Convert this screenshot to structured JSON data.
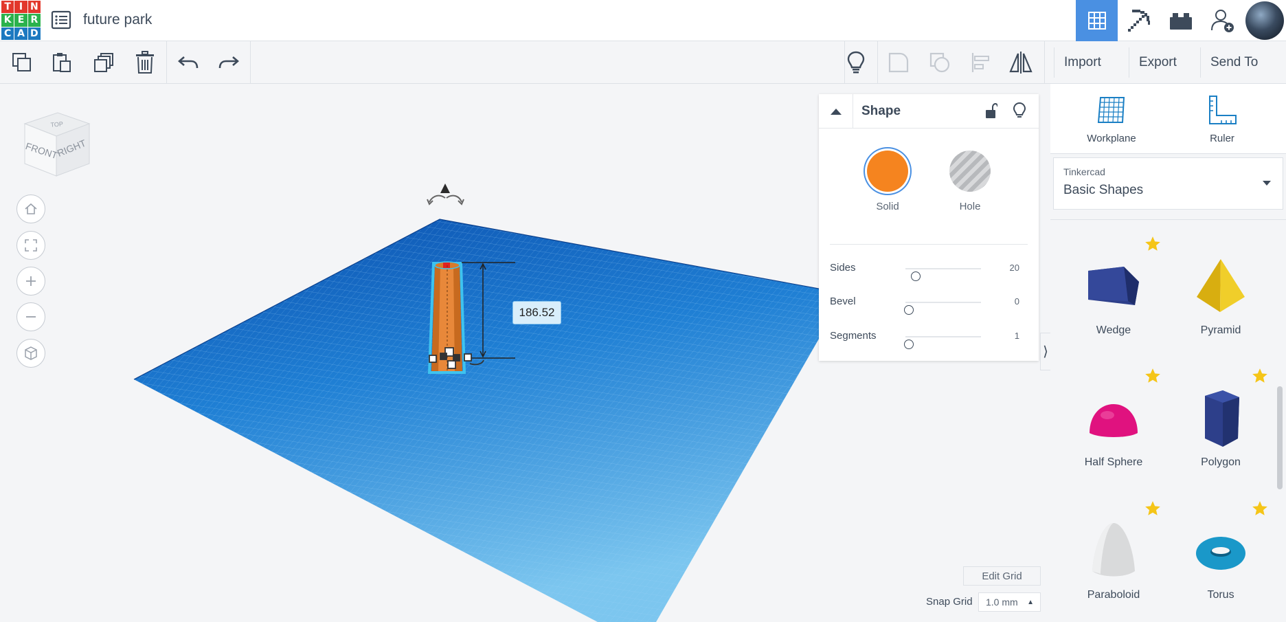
{
  "app": {
    "logo_letters": [
      "T",
      "I",
      "N",
      "K",
      "E",
      "R",
      "C",
      "A",
      "D"
    ],
    "logo_colors": [
      "#e2372b",
      "#e2372b",
      "#e2372b",
      "#2bb24c",
      "#2bb24c",
      "#2bb24c",
      "#1c79c0",
      "#1c79c0",
      "#1c79c0"
    ],
    "title": "future park",
    "accent": "#4a90e2"
  },
  "top_nav": {
    "items": [
      {
        "icon": "grid-3d-icon",
        "active": true
      },
      {
        "icon": "pickaxe-icon",
        "active": false
      },
      {
        "icon": "bricks-icon",
        "active": false
      },
      {
        "icon": "add-user-icon",
        "active": false
      }
    ]
  },
  "toolbar": {
    "actions": [
      "copy-icon",
      "paste-icon",
      "duplicate-icon",
      "delete-icon",
      "undo-icon",
      "redo-icon"
    ],
    "right_actions": [
      "notes-bulb-icon",
      "group-icon",
      "ungroup-icon",
      "align-icon",
      "mirror-icon"
    ],
    "import_label": "Import",
    "export_label": "Export",
    "send_to_label": "Send To"
  },
  "viewport": {
    "view_cube": {
      "top": "TOP",
      "front": "FRONT",
      "right": "RIGHT"
    },
    "nav_buttons": [
      "home-icon",
      "fit-view-icon",
      "zoom-in-icon",
      "zoom-out-icon",
      "perspective-icon"
    ],
    "dimension_label": "186.52",
    "edit_grid_label": "Edit Grid",
    "snap_grid_label": "Snap Grid",
    "snap_grid_value": "1.0 mm",
    "workplane_color": "#2a82d6",
    "selected_shape_color": "#e07a2a",
    "selection_outline_color": "#3ec3ef"
  },
  "inspector": {
    "title": "Shape",
    "solid_label": "Solid",
    "hole_label": "Hole",
    "solid_color": "#f5841f",
    "properties": [
      {
        "label": "Sides",
        "value": "20",
        "level": 0.1
      },
      {
        "label": "Bevel",
        "value": "0",
        "level": 0
      },
      {
        "label": "Segments",
        "value": "1",
        "level": 0
      }
    ]
  },
  "right_panel": {
    "workplane_label": "Workplane",
    "ruler_label": "Ruler",
    "library_source": "Tinkercad",
    "library_name": "Basic Shapes",
    "shapes": [
      {
        "name": "Wedge",
        "starred": true,
        "color": "#2d3f8a"
      },
      {
        "name": "Pyramid",
        "starred": false,
        "color": "#e8c21a"
      },
      {
        "name": "Half Sphere",
        "starred": true,
        "color": "#e0127f"
      },
      {
        "name": "Polygon",
        "starred": true,
        "color": "#2d3f8a"
      },
      {
        "name": "Paraboloid",
        "starred": true,
        "color": "#d9dadb"
      },
      {
        "name": "Torus",
        "starred": true,
        "color": "#1a98c9"
      }
    ]
  }
}
